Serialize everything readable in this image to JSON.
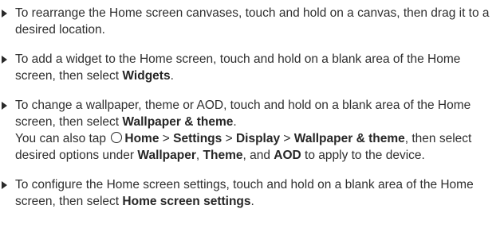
{
  "items": [
    {
      "text": "To rearrange the Home screen canvases, touch and hold on a canvas, then drag it to a desired location."
    },
    {
      "text_before": "To add a widget to the Home screen, touch and hold on a blank area of the Home screen, then select ",
      "bold": "Widgets",
      "text_after": "."
    },
    {
      "line1_before": "To change a wallpaper, theme or AOD, touch and hold on a blank area of the Home screen, then select ",
      "line1_bold": "Wallpaper & theme",
      "line1_after": ".",
      "line2_prefix": "You can also tap",
      "line2_icon": "home-circle-icon",
      "path": [
        "Home",
        "Settings",
        "Display",
        "Wallpaper & theme"
      ],
      "path_separator": " > ",
      "line2_mid": ", then select desired options under ",
      "options": [
        "Wallpaper",
        "Theme",
        "AOD"
      ],
      "options_sep1": ", ",
      "options_sep2": ", and ",
      "line2_after": " to apply to the device."
    },
    {
      "text_before": "To configure the Home screen settings, touch and hold on a blank area of the Home screen, then select ",
      "bold": "Home screen settings",
      "text_after": "."
    }
  ]
}
